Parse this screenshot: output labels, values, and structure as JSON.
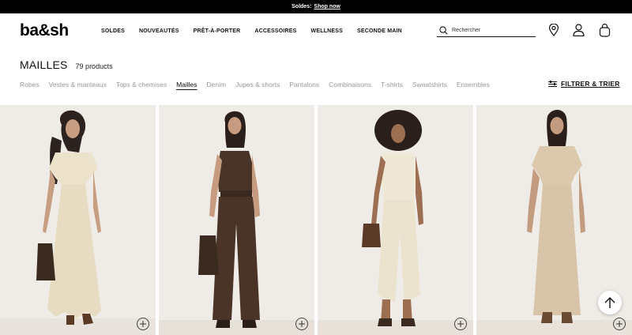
{
  "promo": {
    "text": "Soldes:",
    "link": "Shop now"
  },
  "brand": {
    "logo": "ba&sh"
  },
  "nav": [
    "SOLDES",
    "NOUVEAUTÉS",
    "PRÊT-À-PORTER",
    "ACCESSOIRES",
    "WELLNESS",
    "SECONDE MAIN"
  ],
  "search": {
    "placeholder": "Rechercher"
  },
  "header_icons": [
    "location-pin-icon",
    "account-icon",
    "bag-icon"
  ],
  "page": {
    "title": "MAILLES",
    "count": "79 products"
  },
  "categories": [
    "Robes",
    "Vestes & manteaux",
    "Tops & chemises",
    "Mailles",
    "Denim",
    "Jupes & shorts",
    "Pantalons",
    "Combinaisons",
    "T-shirts",
    "Sweatshirts",
    "Ensembles"
  ],
  "active_category": "Mailles",
  "filter": {
    "label": "FILTRER & TRIER"
  },
  "products": [
    {
      "outfit": "cream crochet maxi dress",
      "color": "#ece3cf"
    },
    {
      "outfit": "brown knit cami and wide trousers",
      "color": "#4a3427"
    },
    {
      "outfit": "ivory knit jumpsuit",
      "color": "#f0e8d6"
    },
    {
      "outfit": "beige wrap maxi dress",
      "color": "#d8c4a8"
    }
  ],
  "colors": {
    "promo_bg": "#000000",
    "card_bg": "#efebe6",
    "text": "#111111",
    "muted": "#999999"
  }
}
